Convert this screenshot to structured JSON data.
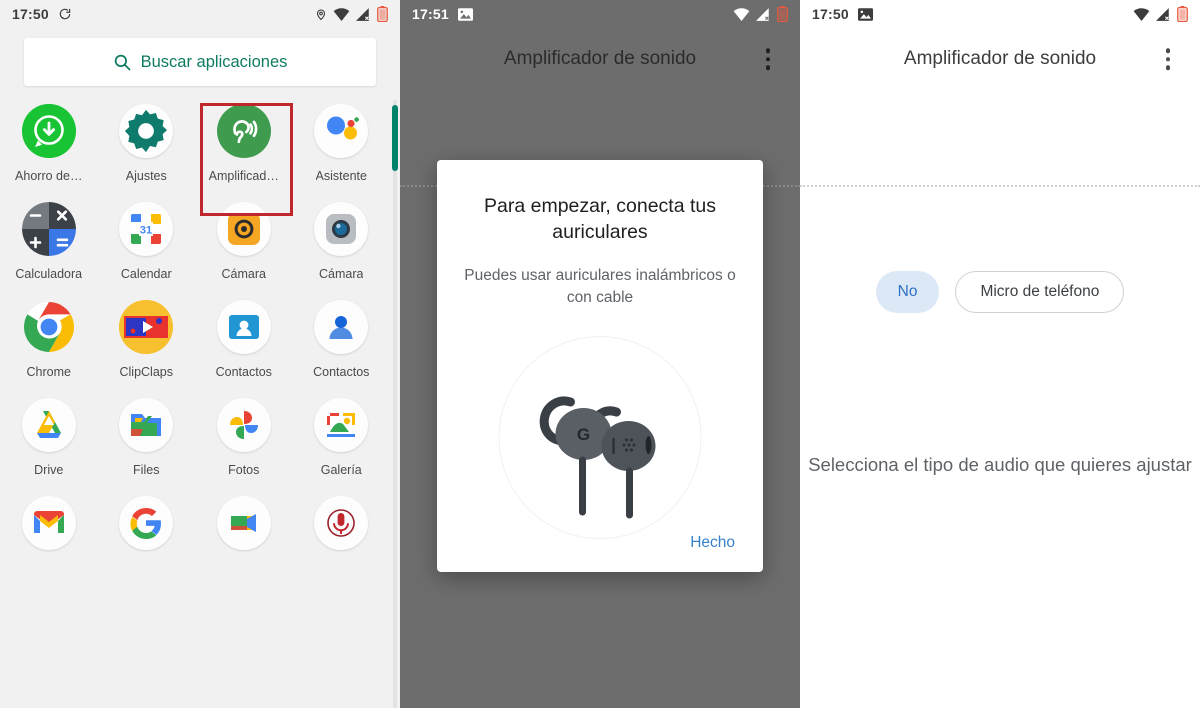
{
  "panel1": {
    "statusbar": {
      "time": "17:50",
      "left_icons": [
        "sync-icon"
      ],
      "right_icons": [
        "location-pin-icon",
        "wifi-icon",
        "signal-no-sim-icon",
        "battery-low-icon"
      ]
    },
    "search": {
      "icon": "search-icon",
      "label": "Buscar aplicaciones"
    },
    "apps": [
      {
        "label": "Ahorro de…",
        "icon": "whatsapp-saver-icon"
      },
      {
        "label": "Ajustes",
        "icon": "gear-icon"
      },
      {
        "label": "Amplificad…",
        "icon": "sound-amplifier-ear-icon",
        "highlighted": true
      },
      {
        "label": "Asistente",
        "icon": "google-assistant-icon"
      },
      {
        "label": "Calculadora",
        "icon": "calculator-icon"
      },
      {
        "label": "Calendar",
        "icon": "google-calendar-icon",
        "day": "31"
      },
      {
        "label": "Cámara",
        "icon": "camera-yellow-icon"
      },
      {
        "label": "Cámara",
        "icon": "camera-lens-icon"
      },
      {
        "label": "Chrome",
        "icon": "chrome-icon"
      },
      {
        "label": "ClipClaps",
        "icon": "clipclaps-icon"
      },
      {
        "label": "Contactos",
        "icon": "contacts-card-icon"
      },
      {
        "label": "Contactos",
        "icon": "contacts-person-icon"
      },
      {
        "label": "Drive",
        "icon": "google-drive-icon"
      },
      {
        "label": "Files",
        "icon": "google-files-icon"
      },
      {
        "label": "Fotos",
        "icon": "google-photos-icon"
      },
      {
        "label": "Galería",
        "icon": "gallery-icon"
      },
      {
        "label": "",
        "icon": "gmail-icon"
      },
      {
        "label": "",
        "icon": "google-search-icon"
      },
      {
        "label": "",
        "icon": "google-meet-icon"
      },
      {
        "label": "",
        "icon": "voice-recorder-icon"
      }
    ],
    "scrollbar_color": "#00836b",
    "highlight_color": "#c0272d"
  },
  "panel2": {
    "statusbar": {
      "time": "17:51",
      "left_icons": [
        "screenshot-image-icon"
      ],
      "right_icons": [
        "wifi-icon",
        "signal-no-sim-icon",
        "battery-low-icon"
      ]
    },
    "appbar": {
      "title": "Amplificador de sonido",
      "menu_icon": "more-vert-icon"
    },
    "dialog": {
      "title": "Para empezar, conecta tus auriculares",
      "subtitle": "Puedes usar auriculares inalámbricos o con cable",
      "illustration": "google-earbuds-icon",
      "earbud_mark": "G",
      "action_label": "Hecho",
      "action_color": "#3780c9"
    }
  },
  "panel3": {
    "statusbar": {
      "time": "17:50",
      "left_icons": [
        "screenshot-image-icon"
      ],
      "right_icons": [
        "wifi-icon",
        "signal-no-sim-icon",
        "battery-low-icon"
      ]
    },
    "appbar": {
      "title": "Amplificador de sonido",
      "menu_icon": "more-vert-icon"
    },
    "chips": [
      {
        "label": "No",
        "style": "filled-blue",
        "highlighted": false
      },
      {
        "label": "Micro de teléfono",
        "style": "outlined",
        "highlighted": true
      }
    ],
    "hint": "Selecciona el tipo de audio que quieres ajustar",
    "highlight_color": "#c0272d"
  }
}
